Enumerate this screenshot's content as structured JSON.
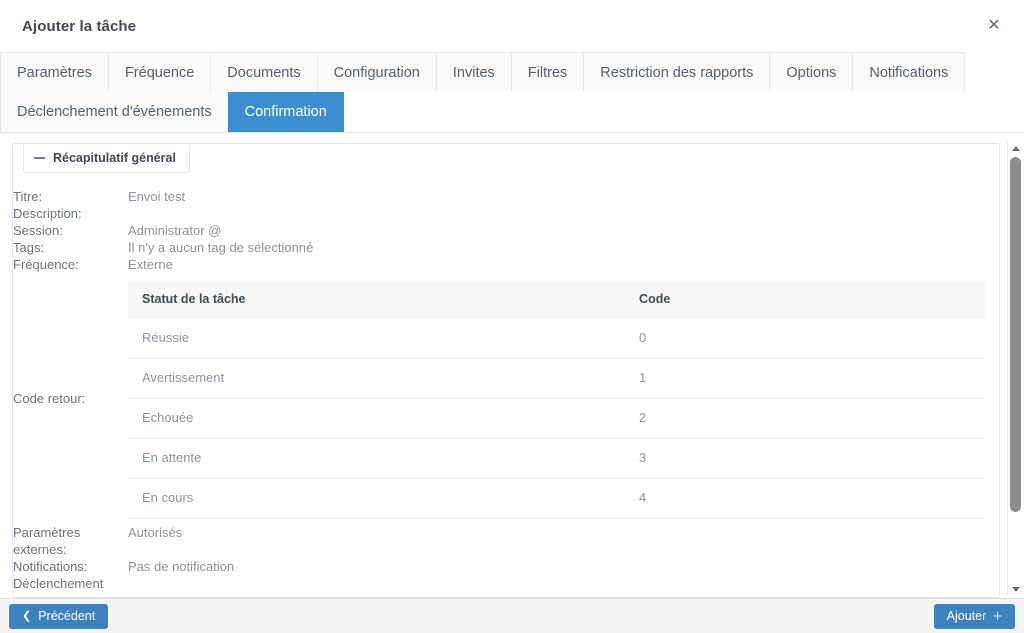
{
  "header": {
    "title": "Ajouter la tâche",
    "close_label": "✕",
    "close_icon": "close-icon"
  },
  "tabs": {
    "row1": [
      {
        "label": "Paramètres",
        "active": false
      },
      {
        "label": "Fréquence",
        "active": false
      },
      {
        "label": "Documents",
        "active": false
      },
      {
        "label": "Configuration",
        "active": false
      },
      {
        "label": "Invites",
        "active": false
      },
      {
        "label": "Filtres",
        "active": false
      },
      {
        "label": "Restriction des rapports",
        "active": false
      },
      {
        "label": "Options",
        "active": false
      },
      {
        "label": "Notifications",
        "active": false
      }
    ],
    "row2": [
      {
        "label": "Déclenchement d'événements",
        "active": false
      },
      {
        "label": "Confirmation",
        "active": true
      }
    ]
  },
  "panel": {
    "legend": "Récapitulatif général",
    "collapse_icon": "minus-icon",
    "rows": [
      {
        "label": "Titre:",
        "value": "Envoi test"
      },
      {
        "label": "Description:",
        "value": ""
      },
      {
        "label": "Session:",
        "value": "Administrator @"
      },
      {
        "label": "Tags:",
        "value": "Il n'y a aucun tag de sélectionné"
      },
      {
        "label": "Fréquence:",
        "value": "Externe"
      }
    ],
    "code_retour_label": "Code retour:",
    "code_table": {
      "columns": [
        "Statut de la tâche",
        "Code"
      ],
      "rows": [
        [
          "Réussie",
          "0"
        ],
        [
          "Avertissement",
          "1"
        ],
        [
          "Echouée",
          "2"
        ],
        [
          "En attente",
          "3"
        ],
        [
          "En cours",
          "4"
        ]
      ]
    },
    "rows_after": [
      {
        "label": "Paramètres externes:",
        "value": "Autorisés"
      },
      {
        "label": "Notifications:",
        "value": "Pas de notification"
      },
      {
        "label": "Déclenchement",
        "value": ""
      }
    ]
  },
  "scrollbar": {
    "up_icon": "chevron-up-icon",
    "down_icon": "chevron-down-icon"
  },
  "footer": {
    "prev_label": "Précédent",
    "prev_icon": "chevron-left-icon",
    "add_label": "Ajouter",
    "add_icon": "plus-icon"
  },
  "colors": {
    "accent": "#3b8fd0",
    "button": "#3b82bf",
    "text_muted": "#8c949f",
    "text_label": "#6a7482",
    "footer_bg": "#f4f4f4"
  }
}
